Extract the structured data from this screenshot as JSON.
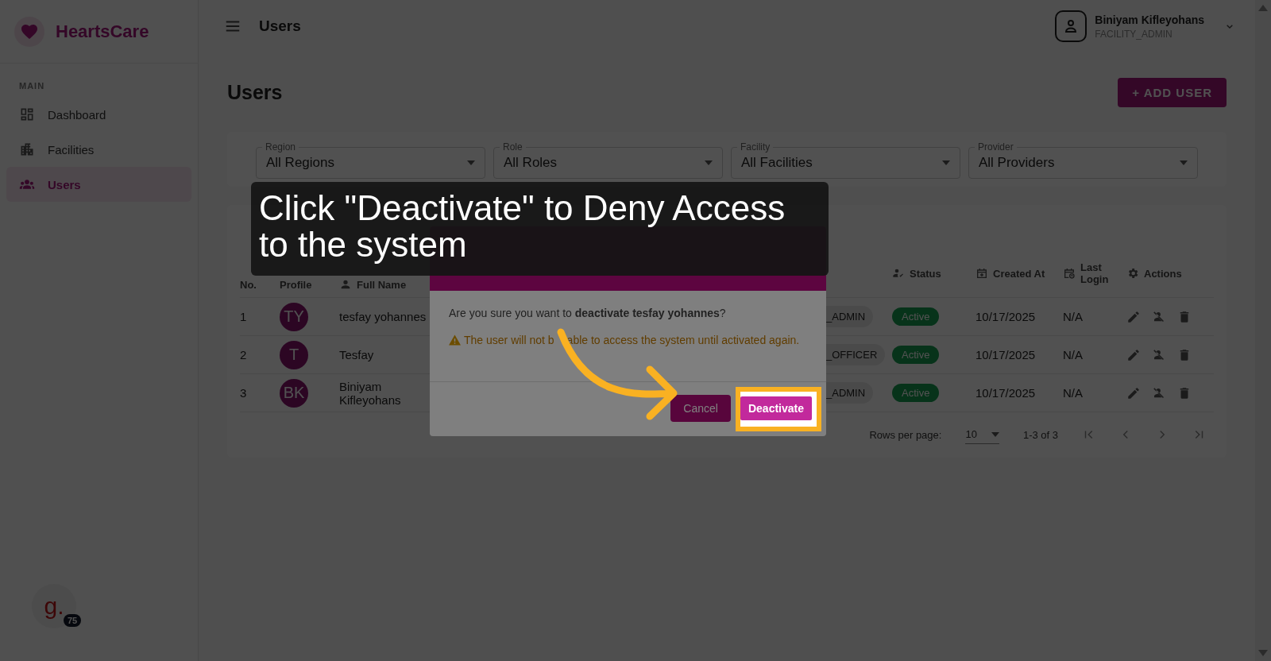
{
  "sidebar": {
    "brand": "HeartsCare",
    "section": "MAIN",
    "items": [
      {
        "label": "Dashboard",
        "kind": "grid",
        "selected": false
      },
      {
        "label": "Facilities",
        "kind": "building",
        "selected": false
      },
      {
        "label": "Users",
        "kind": "people",
        "selected": true
      }
    ]
  },
  "header": {
    "title": "Users",
    "user": {
      "name": "Biniyam Kifleyohans",
      "role": "FACILITY_ADMIN"
    }
  },
  "page": {
    "title": "Users",
    "add_button": "+ ADD USER"
  },
  "filters": [
    {
      "label": "Region",
      "value": "All Regions"
    },
    {
      "label": "Role",
      "value": "All Roles"
    },
    {
      "label": "Facility",
      "value": "All Facilities"
    },
    {
      "label": "Provider",
      "value": "All Providers"
    }
  ],
  "table": {
    "columns": [
      {
        "label": "No.",
        "kind": "plain"
      },
      {
        "label": "Profile",
        "kind": "plain"
      },
      {
        "label": "Full Name",
        "kind": "person"
      },
      {
        "label": "Status",
        "kind": "status"
      },
      {
        "label": "Created At",
        "kind": "date"
      },
      {
        "label": "Last Login",
        "kind": "time"
      },
      {
        "label": "Actions",
        "kind": "settings"
      }
    ],
    "rows": [
      {
        "no": "1",
        "initials": "TY",
        "name": "tesfay yohannes",
        "role": "_ADMIN",
        "status": "Active",
        "created": "10/17/2025",
        "last_login": "N/A"
      },
      {
        "no": "2",
        "initials": "T",
        "name": "Tesfay",
        "role": "_OFFICER",
        "status": "Active",
        "created": "10/17/2025",
        "last_login": "N/A"
      },
      {
        "no": "3",
        "initials": "BK",
        "name": "Biniyam Kifleyohans",
        "role": "_ADMIN",
        "status": "Active",
        "created": "10/17/2025",
        "last_login": "N/A"
      }
    ],
    "pagination": {
      "rows_label": "Rows per page:",
      "rows_value": "10",
      "range": "1-3 of 3"
    }
  },
  "dialog": {
    "message": "Are you sure you want to **deactivate tesfay yohannes**?",
    "warning": [
      "The user will not b",
      "able to access the system until activated again."
    ],
    "cancel": "Cancel",
    "confirm": "Deactivate"
  },
  "tooltip": {
    "text": "Click \"Deactivate\" to Deny Access to the system"
  },
  "widget": {
    "letter": "g.",
    "count": "75"
  }
}
